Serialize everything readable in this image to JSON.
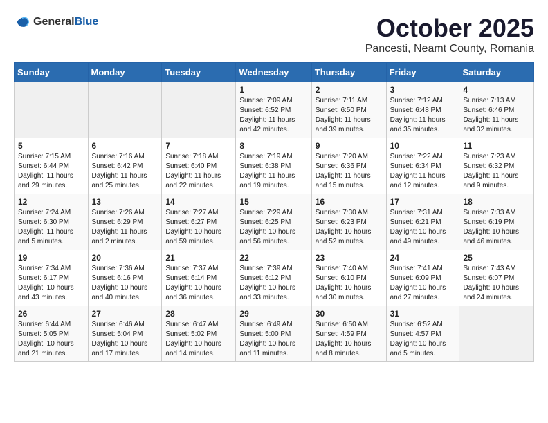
{
  "header": {
    "logo_general": "General",
    "logo_blue": "Blue",
    "month": "October 2025",
    "location": "Pancesti, Neamt County, Romania"
  },
  "weekdays": [
    "Sunday",
    "Monday",
    "Tuesday",
    "Wednesday",
    "Thursday",
    "Friday",
    "Saturday"
  ],
  "weeks": [
    [
      {
        "day": "",
        "info": ""
      },
      {
        "day": "",
        "info": ""
      },
      {
        "day": "",
        "info": ""
      },
      {
        "day": "1",
        "info": "Sunrise: 7:09 AM\nSunset: 6:52 PM\nDaylight: 11 hours\nand 42 minutes."
      },
      {
        "day": "2",
        "info": "Sunrise: 7:11 AM\nSunset: 6:50 PM\nDaylight: 11 hours\nand 39 minutes."
      },
      {
        "day": "3",
        "info": "Sunrise: 7:12 AM\nSunset: 6:48 PM\nDaylight: 11 hours\nand 35 minutes."
      },
      {
        "day": "4",
        "info": "Sunrise: 7:13 AM\nSunset: 6:46 PM\nDaylight: 11 hours\nand 32 minutes."
      }
    ],
    [
      {
        "day": "5",
        "info": "Sunrise: 7:15 AM\nSunset: 6:44 PM\nDaylight: 11 hours\nand 29 minutes."
      },
      {
        "day": "6",
        "info": "Sunrise: 7:16 AM\nSunset: 6:42 PM\nDaylight: 11 hours\nand 25 minutes."
      },
      {
        "day": "7",
        "info": "Sunrise: 7:18 AM\nSunset: 6:40 PM\nDaylight: 11 hours\nand 22 minutes."
      },
      {
        "day": "8",
        "info": "Sunrise: 7:19 AM\nSunset: 6:38 PM\nDaylight: 11 hours\nand 19 minutes."
      },
      {
        "day": "9",
        "info": "Sunrise: 7:20 AM\nSunset: 6:36 PM\nDaylight: 11 hours\nand 15 minutes."
      },
      {
        "day": "10",
        "info": "Sunrise: 7:22 AM\nSunset: 6:34 PM\nDaylight: 11 hours\nand 12 minutes."
      },
      {
        "day": "11",
        "info": "Sunrise: 7:23 AM\nSunset: 6:32 PM\nDaylight: 11 hours\nand 9 minutes."
      }
    ],
    [
      {
        "day": "12",
        "info": "Sunrise: 7:24 AM\nSunset: 6:30 PM\nDaylight: 11 hours\nand 5 minutes."
      },
      {
        "day": "13",
        "info": "Sunrise: 7:26 AM\nSunset: 6:29 PM\nDaylight: 11 hours\nand 2 minutes."
      },
      {
        "day": "14",
        "info": "Sunrise: 7:27 AM\nSunset: 6:27 PM\nDaylight: 10 hours\nand 59 minutes."
      },
      {
        "day": "15",
        "info": "Sunrise: 7:29 AM\nSunset: 6:25 PM\nDaylight: 10 hours\nand 56 minutes."
      },
      {
        "day": "16",
        "info": "Sunrise: 7:30 AM\nSunset: 6:23 PM\nDaylight: 10 hours\nand 52 minutes."
      },
      {
        "day": "17",
        "info": "Sunrise: 7:31 AM\nSunset: 6:21 PM\nDaylight: 10 hours\nand 49 minutes."
      },
      {
        "day": "18",
        "info": "Sunrise: 7:33 AM\nSunset: 6:19 PM\nDaylight: 10 hours\nand 46 minutes."
      }
    ],
    [
      {
        "day": "19",
        "info": "Sunrise: 7:34 AM\nSunset: 6:17 PM\nDaylight: 10 hours\nand 43 minutes."
      },
      {
        "day": "20",
        "info": "Sunrise: 7:36 AM\nSunset: 6:16 PM\nDaylight: 10 hours\nand 40 minutes."
      },
      {
        "day": "21",
        "info": "Sunrise: 7:37 AM\nSunset: 6:14 PM\nDaylight: 10 hours\nand 36 minutes."
      },
      {
        "day": "22",
        "info": "Sunrise: 7:39 AM\nSunset: 6:12 PM\nDaylight: 10 hours\nand 33 minutes."
      },
      {
        "day": "23",
        "info": "Sunrise: 7:40 AM\nSunset: 6:10 PM\nDaylight: 10 hours\nand 30 minutes."
      },
      {
        "day": "24",
        "info": "Sunrise: 7:41 AM\nSunset: 6:09 PM\nDaylight: 10 hours\nand 27 minutes."
      },
      {
        "day": "25",
        "info": "Sunrise: 7:43 AM\nSunset: 6:07 PM\nDaylight: 10 hours\nand 24 minutes."
      }
    ],
    [
      {
        "day": "26",
        "info": "Sunrise: 6:44 AM\nSunset: 5:05 PM\nDaylight: 10 hours\nand 21 minutes."
      },
      {
        "day": "27",
        "info": "Sunrise: 6:46 AM\nSunset: 5:04 PM\nDaylight: 10 hours\nand 17 minutes."
      },
      {
        "day": "28",
        "info": "Sunrise: 6:47 AM\nSunset: 5:02 PM\nDaylight: 10 hours\nand 14 minutes."
      },
      {
        "day": "29",
        "info": "Sunrise: 6:49 AM\nSunset: 5:00 PM\nDaylight: 10 hours\nand 11 minutes."
      },
      {
        "day": "30",
        "info": "Sunrise: 6:50 AM\nSunset: 4:59 PM\nDaylight: 10 hours\nand 8 minutes."
      },
      {
        "day": "31",
        "info": "Sunrise: 6:52 AM\nSunset: 4:57 PM\nDaylight: 10 hours\nand 5 minutes."
      },
      {
        "day": "",
        "info": ""
      }
    ]
  ]
}
